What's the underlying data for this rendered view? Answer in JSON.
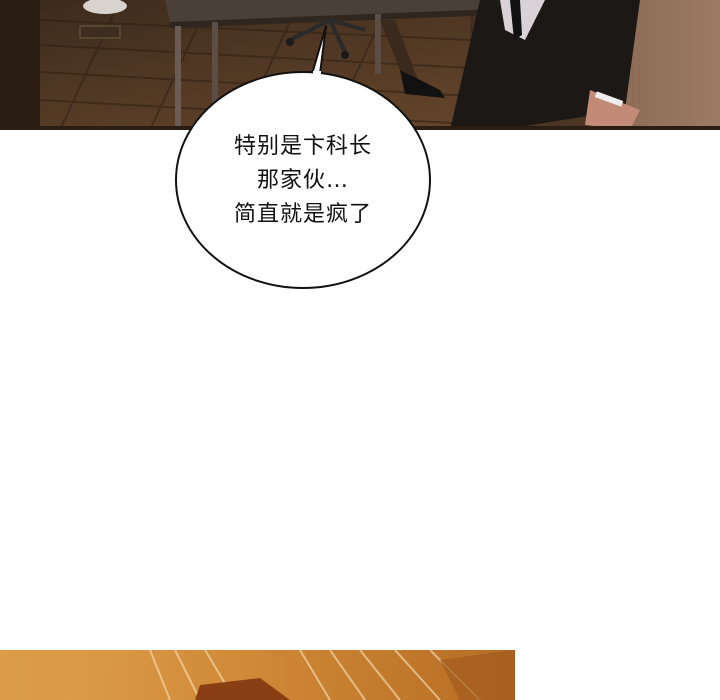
{
  "speech_bubble": {
    "lines": [
      "特别是卞科长",
      "那家伙…",
      "简直就是疯了"
    ]
  }
}
